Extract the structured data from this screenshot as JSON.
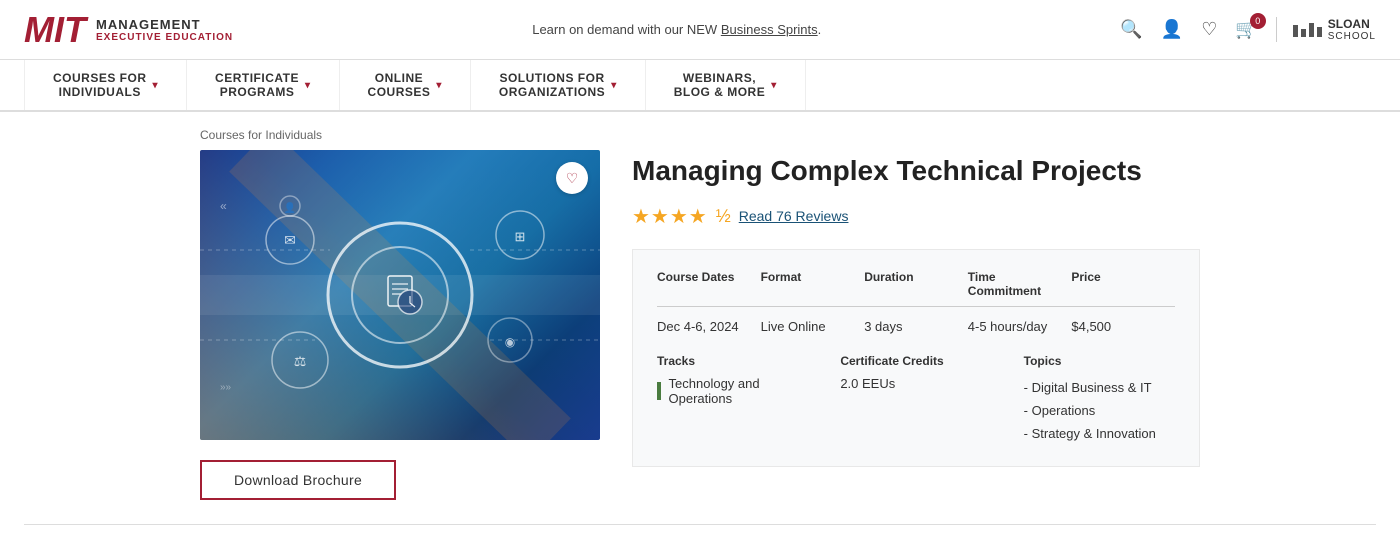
{
  "topbar": {
    "mit_logo": "MIT",
    "management": "MANAGEMENT",
    "executive": "EXECUTIVE EDUCATION",
    "notice": "Learn on demand with our NEW ",
    "notice_link": "Business Sprints",
    "notice_end": ".",
    "cart_count": "0"
  },
  "sloan": {
    "mit": "|||",
    "label1": "SLOAN",
    "label2": "SCHOOL"
  },
  "nav": {
    "items": [
      {
        "label": "COURSES FOR\nINDIVIDUALS",
        "has_chevron": true
      },
      {
        "label": "CERTIFICATE\nPROGRAMS",
        "has_chevron": true
      },
      {
        "label": "ONLINE\nCOURSES",
        "has_chevron": true
      },
      {
        "label": "SOLUTIONS FOR\nORGANIZATIONS",
        "has_chevron": true
      },
      {
        "label": "WEBINARS,\nBLOG & MORE",
        "has_chevron": true
      }
    ]
  },
  "breadcrumb": "Courses for Individuals",
  "course": {
    "title": "Managing Complex Technical Projects",
    "stars": "★★★★",
    "half_star": "½",
    "reviews_text": "Read 76 Reviews",
    "table": {
      "headers": [
        "Course Dates",
        "Format",
        "Duration",
        "Time Commitment",
        "Price"
      ],
      "rows": [
        [
          "Dec 4-6, 2024",
          "Live Online",
          "3 days",
          "4-5 hours/day",
          "$4,500"
        ]
      ]
    },
    "tracks_label": "Tracks",
    "tracks": [
      "Technology and Operations"
    ],
    "credits_label": "Certificate Credits",
    "credits": "2.0 EEUs",
    "topics_label": "Topics",
    "topics": [
      "- Digital Business & IT",
      "- Operations",
      "- Strategy & Innovation"
    ]
  },
  "buttons": {
    "download": "Download Brochure",
    "favorite": "♡"
  }
}
